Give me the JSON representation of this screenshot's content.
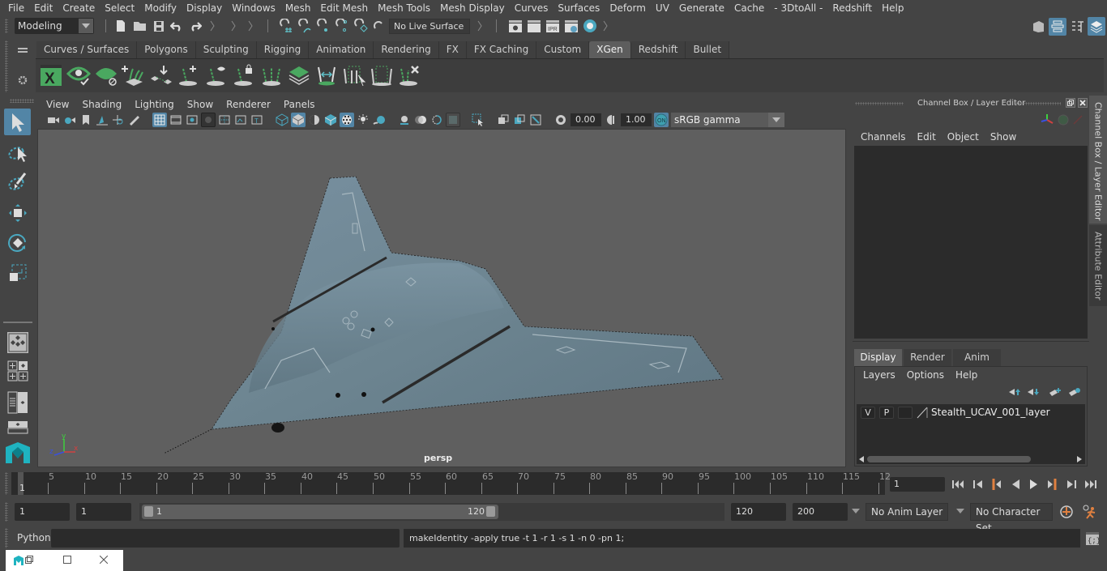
{
  "menubar": {
    "items": [
      "File",
      "Edit",
      "Create",
      "Select",
      "Modify",
      "Display",
      "Windows",
      "Mesh",
      "Edit Mesh",
      "Mesh Tools",
      "Mesh Display",
      "Curves",
      "Surfaces",
      "Deform",
      "UV",
      "Generate",
      "Cache",
      "- 3DtoAll -",
      "Redshift",
      "Help"
    ]
  },
  "statusline": {
    "mode": "Modeling",
    "live_surface": "No Live Surface",
    "icons": [
      "new-scene-icon",
      "open-scene-icon",
      "save-scene-icon",
      "undo-icon",
      "redo-icon",
      "snap-grid-icon",
      "snap-curve-icon",
      "snap-point-icon",
      "snap-view-plane-icon",
      "make-live-icon",
      "snap-surface-icon",
      "render-view-icon",
      "render-current-icon",
      "ipr-render-icon",
      "render-settings-icon",
      "hypershade-icon"
    ],
    "right_icons": [
      "modeling-toolkit-icon",
      "attribute-editor-icon",
      "tool-settings-icon",
      "channel-box-icon"
    ]
  },
  "shelf": {
    "tabs": [
      "Curves / Surfaces",
      "Polygons",
      "Sculpting",
      "Rigging",
      "Animation",
      "Rendering",
      "FX",
      "FX Caching",
      "Custom",
      "XGen",
      "Redshift",
      "Bullet"
    ],
    "active_tab": "XGen",
    "icons": [
      "xgen-editor-icon",
      "xgen-preview-icon",
      "xgen-clear-preview-icon",
      "create-description-icon",
      "place-guides-icon",
      "add-guide-icon",
      "show-guides-icon",
      "lock-guides-icon",
      "rebuild-guides-icon",
      "paint-density-icon",
      "flip-guides-icon",
      "select-guides-icon",
      "deselect-guides-icon",
      "delete-guides-icon"
    ]
  },
  "toolbox": {
    "tools": [
      "select-tool-icon",
      "lasso-select-icon",
      "paint-select-icon",
      "move-tool-icon",
      "rotate-tool-icon",
      "scale-tool-icon"
    ],
    "layouts": [
      "single-pane-layout-icon",
      "four-pane-layout-icon",
      "outliner-persp-layout-icon",
      "persp-graph-layout-icon"
    ]
  },
  "viewport": {
    "menu": [
      "View",
      "Shading",
      "Lighting",
      "Show",
      "Renderer",
      "Panels"
    ],
    "exposure": "0.00",
    "gamma": "1.00",
    "color_space": "sRGB gamma",
    "camera_label": "persp",
    "axis": {
      "x": "x",
      "y": "y",
      "z": "z"
    },
    "model_color": "#6d8591"
  },
  "channel_box": {
    "title": "Channel Box / Layer Editor",
    "menu": [
      "Channels",
      "Edit",
      "Object",
      "Show"
    ],
    "side_tabs": [
      "Channel Box / Layer Editor",
      "Attribute Editor"
    ]
  },
  "layer_editor": {
    "tabs": [
      "Display",
      "Render",
      "Anim"
    ],
    "active_tab": "Display",
    "menu": [
      "Layers",
      "Options",
      "Help"
    ],
    "layers": [
      {
        "visible": "V",
        "playback": "P",
        "name": "Stealth_UCAV_001_layer"
      }
    ]
  },
  "timeline": {
    "ticks": [
      "5",
      "10",
      "15",
      "20",
      "25",
      "30",
      "35",
      "40",
      "45",
      "50",
      "55",
      "60",
      "65",
      "70",
      "75",
      "80",
      "85",
      "90",
      "95",
      "100",
      "105",
      "110",
      "115",
      "12"
    ],
    "current_frame_marker": "1",
    "current_frame": "1"
  },
  "range": {
    "start_time": "1",
    "playback_start": "1",
    "slider_start": "1",
    "slider_end": "120",
    "playback_end": "120",
    "end_time": "200",
    "anim_layer": "No Anim Layer",
    "character_set": "No Character Set"
  },
  "command_line": {
    "language": "Python",
    "input": "",
    "result": "makeIdentity -apply true -t 1 -r 1 -s 1 -n 0 -pn 1;"
  },
  "accent_color": "#5285a6"
}
